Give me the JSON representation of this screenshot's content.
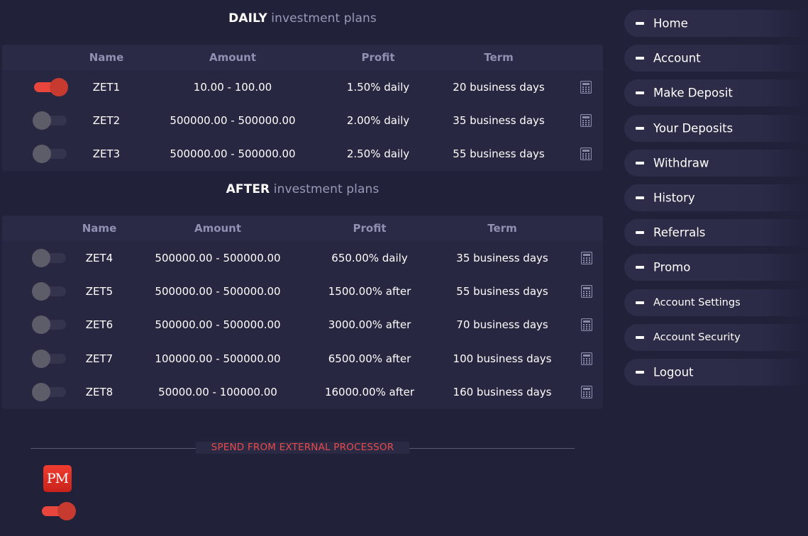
{
  "daily": {
    "title_bold": "DAILY",
    "title_rest": "investment plans",
    "headers": {
      "name": "Name",
      "amount": "Amount",
      "profit": "Profit",
      "term": "Term"
    },
    "rows": [
      {
        "on": true,
        "name": "ZET1",
        "amount": "10.00 - 100.00",
        "profit": "1.50% daily",
        "term": "20 business days"
      },
      {
        "on": false,
        "name": "ZET2",
        "amount": "500000.00 - 500000.00",
        "profit": "2.00% daily",
        "term": "35 business days"
      },
      {
        "on": false,
        "name": "ZET3",
        "amount": "500000.00 - 500000.00",
        "profit": "2.50% daily",
        "term": "55 business days"
      }
    ]
  },
  "after": {
    "title_bold": "AFTER",
    "title_rest": "investment plans",
    "headers": {
      "name": "Name",
      "amount": "Amount",
      "profit": "Profit",
      "term": "Term"
    },
    "rows": [
      {
        "on": false,
        "name": "ZET4",
        "amount": "500000.00 - 500000.00",
        "profit": "650.00% daily",
        "term": "35 business days"
      },
      {
        "on": false,
        "name": "ZET5",
        "amount": "500000.00 - 500000.00",
        "profit": "1500.00% after",
        "term": "55 business days"
      },
      {
        "on": false,
        "name": "ZET6",
        "amount": "500000.00 - 500000.00",
        "profit": "3000.00% after",
        "term": "70 business days"
      },
      {
        "on": false,
        "name": "ZET7",
        "amount": "100000.00 - 500000.00",
        "profit": "6500.00% after",
        "term": "100 business days"
      },
      {
        "on": false,
        "name": "ZET8",
        "amount": "50000.00 - 100000.00",
        "profit": "16000.00% after",
        "term": "160 business days"
      }
    ]
  },
  "processor": {
    "divider_label": "SPEND FROM EXTERNAL PROCESSOR",
    "logo_text": "PM",
    "toggle_on": true
  },
  "icons": {
    "row_action": "calculator-icon",
    "menu_bullet": "dash-icon"
  },
  "colors": {
    "background": "#21213a",
    "accent": "#e8453c",
    "muted_text": "#9090b2"
  },
  "sidebar": {
    "items": [
      {
        "label": "Home"
      },
      {
        "label": "Account"
      },
      {
        "label": "Make Deposit"
      },
      {
        "label": "Your Deposits"
      },
      {
        "label": "Withdraw"
      },
      {
        "label": "History"
      },
      {
        "label": "Referrals"
      },
      {
        "label": "Promo"
      },
      {
        "label": "Account Settings"
      },
      {
        "label": "Account Security"
      },
      {
        "label": "Logout"
      }
    ]
  }
}
